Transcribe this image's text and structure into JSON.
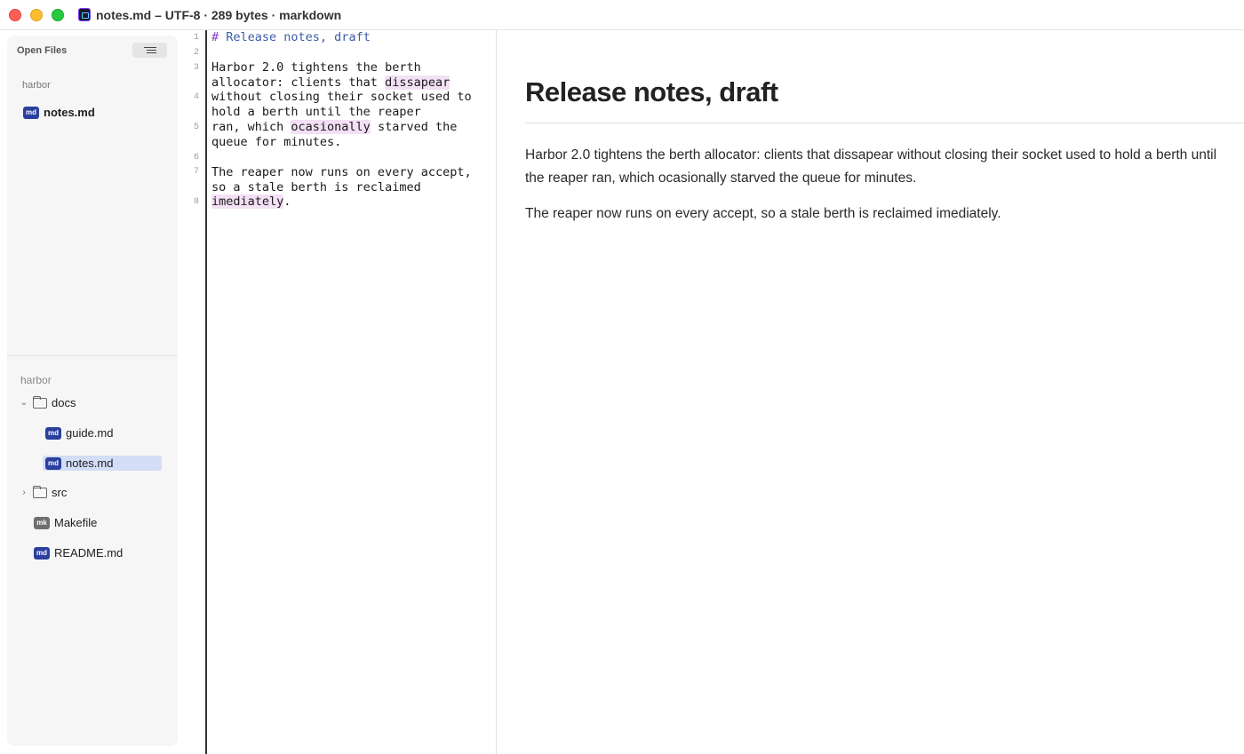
{
  "window": {
    "title": "notes.md – UTF-8 · 289 bytes · markdown"
  },
  "sidebar": {
    "open_files_header": "Open Files",
    "open_group_label": "harbor",
    "open_files": [
      {
        "badge": "md",
        "name": "notes.md"
      }
    ],
    "project_label": "harbor",
    "tree": {
      "docs": {
        "name": "docs",
        "expanded": true
      },
      "guide": {
        "badge": "md",
        "name": "guide.md"
      },
      "notes": {
        "badge": "md",
        "name": "notes.md",
        "selected": true
      },
      "src": {
        "name": "src",
        "expanded": false
      },
      "makefile": {
        "badge": "mk",
        "name": "Makefile"
      },
      "readme": {
        "badge": "md",
        "name": "README.md"
      }
    }
  },
  "editor": {
    "line_numbers": [
      "1",
      "2",
      "3",
      "4",
      "5",
      "6",
      "7",
      "8"
    ],
    "heading_hash": "#",
    "heading_text": " Release notes, draft",
    "l3a": "Harbor 2.0 tightens the berth",
    "l3b_pre": "allocator: clients that ",
    "l3b_word": "dissapear",
    "l4a": "without closing their socket used to",
    "l4b": "hold a berth until the reaper",
    "l5a_pre": "ran, which ",
    "l5a_word": "ocasionally",
    "l5a_post": " starved the",
    "l5b": "queue for minutes.",
    "l7a": "The reaper now runs on every accept,",
    "l7b": "so a stale berth is reclaimed",
    "l8_word": "imediately",
    "l8_post": "."
  },
  "preview": {
    "title": "Release notes, draft",
    "paragraph1": "Harbor 2.0 tightens the berth allocator: clients that dissapear without closing their socket used to hold a berth until the reaper ran, which ocasionally starved the queue for minutes.",
    "paragraph2": "The reaper now runs on every accept, so a stale berth is reclaimed imediately."
  }
}
